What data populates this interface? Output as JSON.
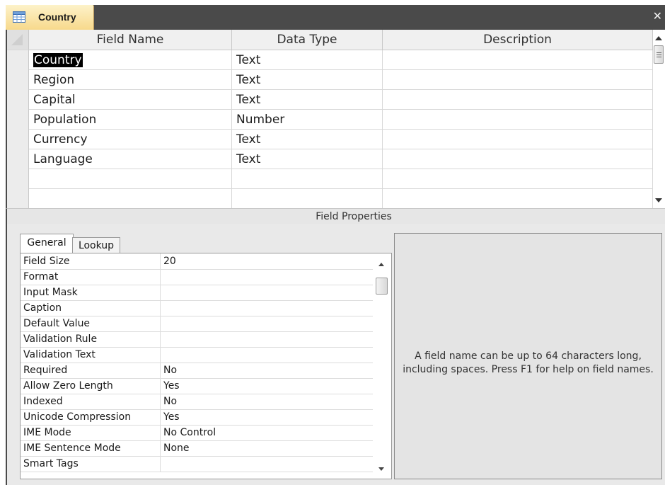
{
  "window": {
    "tab_title": "Country",
    "tab_icon": "table-icon",
    "close_glyph": "✕"
  },
  "grid": {
    "columns": [
      "Field Name",
      "Data Type",
      "Description"
    ],
    "rows": [
      {
        "field": "Country",
        "type": "Text",
        "description": "",
        "selected": true
      },
      {
        "field": "Region",
        "type": "Text",
        "description": ""
      },
      {
        "field": "Capital",
        "type": "Text",
        "description": ""
      },
      {
        "field": "Population",
        "type": "Number",
        "description": ""
      },
      {
        "field": "Currency",
        "type": "Text",
        "description": ""
      },
      {
        "field": "Language",
        "type": "Text",
        "description": ""
      },
      {
        "field": "",
        "type": "",
        "description": ""
      },
      {
        "field": "",
        "type": "",
        "description": ""
      }
    ]
  },
  "field_properties": {
    "title": "Field Properties",
    "tabs": [
      "General",
      "Lookup"
    ],
    "active_tab": "General",
    "properties": [
      {
        "name": "Field Size",
        "value": "20"
      },
      {
        "name": "Format",
        "value": ""
      },
      {
        "name": "Input Mask",
        "value": ""
      },
      {
        "name": "Caption",
        "value": ""
      },
      {
        "name": "Default Value",
        "value": ""
      },
      {
        "name": "Validation Rule",
        "value": ""
      },
      {
        "name": "Validation Text",
        "value": ""
      },
      {
        "name": "Required",
        "value": "No"
      },
      {
        "name": "Allow Zero Length",
        "value": "Yes"
      },
      {
        "name": "Indexed",
        "value": "No"
      },
      {
        "name": "Unicode Compression",
        "value": "Yes"
      },
      {
        "name": "IME Mode",
        "value": "No Control"
      },
      {
        "name": "IME Sentence Mode",
        "value": "None"
      },
      {
        "name": "Smart Tags",
        "value": ""
      }
    ],
    "help_text": "A field name can be up to 64 characters long, including spaces.  Press F1 for help on field names."
  },
  "colors": {
    "tab_background": "#f7d98c",
    "frame_dark": "#4a4a4a",
    "selection": "#000000",
    "panel_gray": "#e9e9e9"
  }
}
